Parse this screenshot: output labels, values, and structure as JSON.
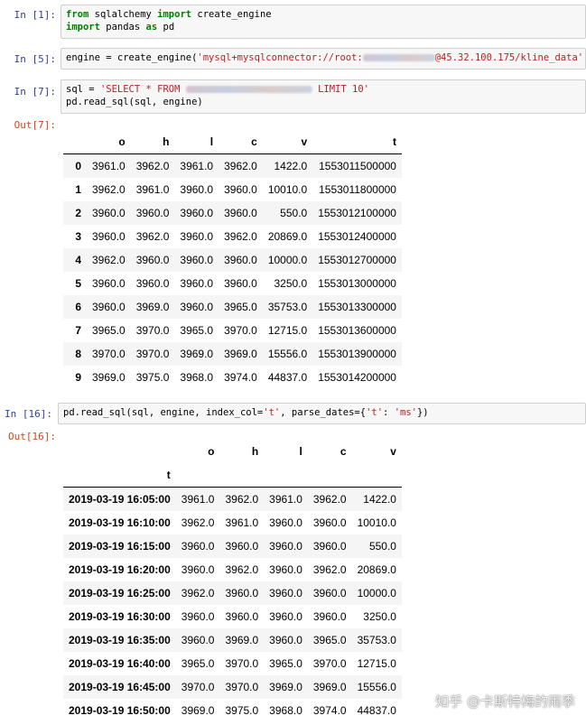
{
  "cells": [
    {
      "prompt": "In  [1]:",
      "code": [
        "from sqlalchemy import create_engine",
        "import pandas as pd"
      ]
    },
    {
      "prompt": "In  [5]:",
      "code_parts": {
        "a": "engine = create_engine(",
        "s1": "'mysql+mysqlconnector://root:",
        "s2": "@45.32.100.175/kline_data'",
        "b": ")"
      }
    },
    {
      "prompt": "In  [7]:",
      "code_parts": {
        "a": "sql = ",
        "s1": "'SELECT * FROM ",
        "s2": " LIMIT 10'",
        "line2": "pd.read_sql(sql, engine)"
      },
      "out_prompt": "Out[7]:"
    },
    {
      "prompt": "In  [16]:",
      "code_parts": {
        "a": "pd.read_sql(sql, engine, index_col=",
        "s1": "'t'",
        "b": ", parse_dates={",
        "s2": "'t'",
        "c": ": ",
        "s3": "'ms'",
        "d": "})"
      },
      "out_prompt": "Out[16]:"
    }
  ],
  "kw": {
    "from": "from",
    "import": "import",
    "as": "as"
  },
  "df1": {
    "columns": [
      "o",
      "h",
      "l",
      "c",
      "v",
      "t"
    ],
    "rows": [
      [
        "0",
        "3961.0",
        "3962.0",
        "3961.0",
        "3962.0",
        "1422.0",
        "1553011500000"
      ],
      [
        "1",
        "3962.0",
        "3961.0",
        "3960.0",
        "3960.0",
        "10010.0",
        "1553011800000"
      ],
      [
        "2",
        "3960.0",
        "3960.0",
        "3960.0",
        "3960.0",
        "550.0",
        "1553012100000"
      ],
      [
        "3",
        "3960.0",
        "3962.0",
        "3960.0",
        "3962.0",
        "20869.0",
        "1553012400000"
      ],
      [
        "4",
        "3962.0",
        "3960.0",
        "3960.0",
        "3960.0",
        "10000.0",
        "1553012700000"
      ],
      [
        "5",
        "3960.0",
        "3960.0",
        "3960.0",
        "3960.0",
        "3250.0",
        "1553013000000"
      ],
      [
        "6",
        "3960.0",
        "3969.0",
        "3960.0",
        "3965.0",
        "35753.0",
        "1553013300000"
      ],
      [
        "7",
        "3965.0",
        "3970.0",
        "3965.0",
        "3970.0",
        "12715.0",
        "1553013600000"
      ],
      [
        "8",
        "3970.0",
        "3970.0",
        "3969.0",
        "3969.0",
        "15556.0",
        "1553013900000"
      ],
      [
        "9",
        "3969.0",
        "3975.0",
        "3968.0",
        "3974.0",
        "44837.0",
        "1553014200000"
      ]
    ]
  },
  "df2": {
    "columns": [
      "o",
      "h",
      "l",
      "c",
      "v"
    ],
    "index_name": "t",
    "rows": [
      [
        "2019-03-19 16:05:00",
        "3961.0",
        "3962.0",
        "3961.0",
        "3962.0",
        "1422.0"
      ],
      [
        "2019-03-19 16:10:00",
        "3962.0",
        "3961.0",
        "3960.0",
        "3960.0",
        "10010.0"
      ],
      [
        "2019-03-19 16:15:00",
        "3960.0",
        "3960.0",
        "3960.0",
        "3960.0",
        "550.0"
      ],
      [
        "2019-03-19 16:20:00",
        "3960.0",
        "3962.0",
        "3960.0",
        "3962.0",
        "20869.0"
      ],
      [
        "2019-03-19 16:25:00",
        "3962.0",
        "3960.0",
        "3960.0",
        "3960.0",
        "10000.0"
      ],
      [
        "2019-03-19 16:30:00",
        "3960.0",
        "3960.0",
        "3960.0",
        "3960.0",
        "3250.0"
      ],
      [
        "2019-03-19 16:35:00",
        "3960.0",
        "3969.0",
        "3960.0",
        "3965.0",
        "35753.0"
      ],
      [
        "2019-03-19 16:40:00",
        "3965.0",
        "3970.0",
        "3965.0",
        "3970.0",
        "12715.0"
      ],
      [
        "2019-03-19 16:45:00",
        "3970.0",
        "3970.0",
        "3969.0",
        "3969.0",
        "15556.0"
      ],
      [
        "2019-03-19 16:50:00",
        "3969.0",
        "3975.0",
        "3968.0",
        "3974.0",
        "44837.0"
      ]
    ]
  },
  "watermark": "知乎 @卡斯特梅的雨季"
}
